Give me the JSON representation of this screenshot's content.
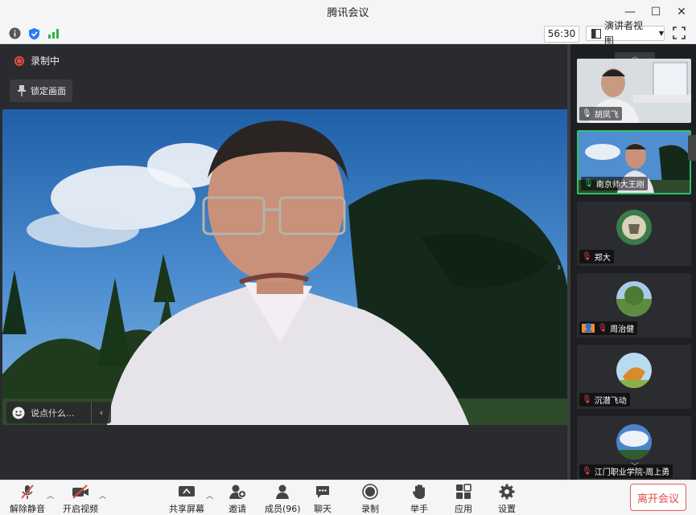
{
  "window": {
    "title": "腾讯会议"
  },
  "statusbar": {
    "timer": "56:30",
    "view_label": "演讲者视图"
  },
  "stage": {
    "recording_label": "录制中",
    "lock_label": "锁定画面",
    "chat_placeholder": "说点什么..."
  },
  "participants": [
    {
      "name": "胡凤飞"
    },
    {
      "name": "南京师大王刚"
    },
    {
      "name": "郑大"
    },
    {
      "name": "周治健"
    },
    {
      "name": "沉潜飞动"
    },
    {
      "name": "江门职业学院-周上勇"
    }
  ],
  "toolbar": {
    "mute": "解除静音",
    "video": "开启视频",
    "share": "共享屏幕",
    "invite": "邀请",
    "members": "成员(96)",
    "chat": "聊天",
    "record": "录制",
    "raise_hand": "举手",
    "apps": "应用",
    "settings": "设置",
    "leave": "离开会议"
  },
  "colors": {
    "accent_green": "#33c06a",
    "record_red": "#e84a44",
    "leave_red": "#e34b45"
  }
}
